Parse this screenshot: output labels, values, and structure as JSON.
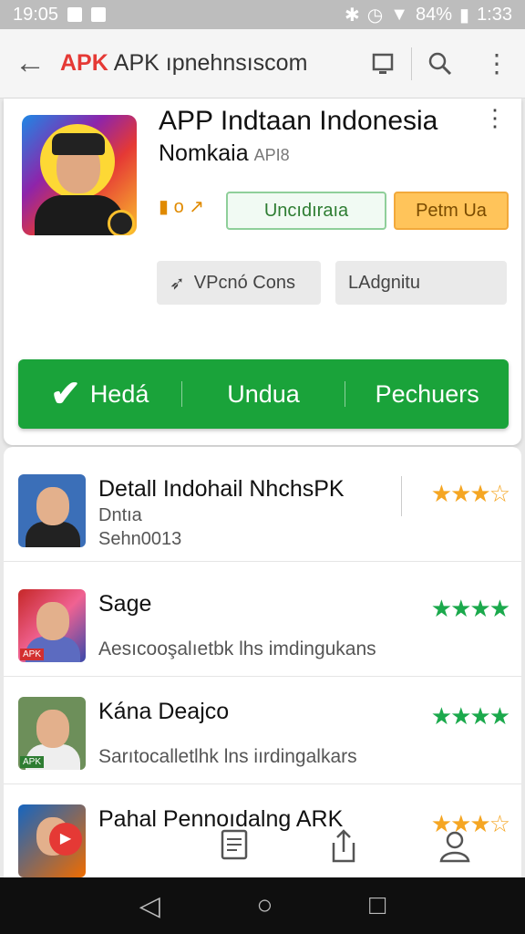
{
  "status": {
    "time_left": "19:05",
    "battery": "84%",
    "time_right": "1:33"
  },
  "toolbar": {
    "brand_logo": "APK",
    "brand_text": "APK ıpnehnsıscom"
  },
  "app": {
    "title": "APP Indtaan Indonesia",
    "developer": "Nomkaia",
    "version": "API8",
    "mini_label": "o",
    "btn_outline": "Uncıdıraıa",
    "btn_orange": "Petm Ua",
    "btn_gray1": "VPcnó Cons",
    "btn_gray2": "LAdgnitu"
  },
  "action_bar": {
    "seg1": "Hedá",
    "seg2": "Undua",
    "seg3": "Pechuers"
  },
  "list": [
    {
      "name": "Detall Indohail NhchsPK",
      "sub1": "Dntıa",
      "sub2": "Sehn0013",
      "stars": "★★★☆",
      "star_color": "#f5a623"
    },
    {
      "name": "Sage",
      "desc": "Aesıcooşalıetbk lhs imdingukans",
      "stars": "★★★★",
      "star_color": "#1ba94c"
    },
    {
      "name": "Kána Deajco",
      "desc": "Sarıtocalletlhk lns iırdingalkars",
      "stars": "★★★★",
      "star_color": "#1ba94c"
    },
    {
      "name": "Pahal Pennoıdalng ARK",
      "stars": "★★★☆",
      "star_color": "#f5a623"
    }
  ],
  "icons": {
    "back": "arrow-left-icon",
    "tablet": "tablet-icon",
    "search": "search-icon",
    "more": "more-vert-icon",
    "share": "share-icon",
    "doc": "document-icon",
    "profile": "profile-icon"
  },
  "colors": {
    "accent_green": "#1aa33a",
    "brand_red": "#e53935",
    "orange": "#ffc45a"
  }
}
